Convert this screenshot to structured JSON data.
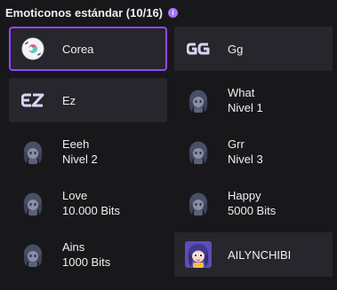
{
  "header": {
    "title": "Emoticonos estándar (10/16)",
    "info_icon": "info-icon",
    "info_glyph": "i"
  },
  "colors": {
    "background": "#18181b",
    "tile": "#26262c",
    "accent": "#9147ff",
    "info": "#a970ff",
    "text": "#efeff1"
  },
  "emotes": [
    {
      "line1": "Corea",
      "line2": "",
      "icon": "korea-flag-badge-icon",
      "state": "selected"
    },
    {
      "line1": "Gg",
      "line2": "",
      "icon": "gg-logo-icon",
      "state": "unlocked"
    },
    {
      "line1": "Ez",
      "line2": "",
      "icon": "ez-logo-icon",
      "state": "unlocked"
    },
    {
      "line1": "What",
      "line2": "Nivel 1",
      "icon": "chibi-silhouette-icon",
      "state": "locked"
    },
    {
      "line1": "Eeeh",
      "line2": "Nivel 2",
      "icon": "chibi-silhouette-icon",
      "state": "locked"
    },
    {
      "line1": "Grr",
      "line2": "Nivel 3",
      "icon": "chibi-silhouette-icon",
      "state": "locked"
    },
    {
      "line1": "Love",
      "line2": "10.000 Bits",
      "icon": "chibi-silhouette-icon",
      "state": "locked"
    },
    {
      "line1": "Happy",
      "line2": "5000 Bits",
      "icon": "chibi-silhouette-icon",
      "state": "locked"
    },
    {
      "line1": "Ains",
      "line2": "1000 Bits",
      "icon": "chibi-silhouette-icon",
      "state": "locked"
    },
    {
      "line1": "AILYNCHIBI",
      "line2": "",
      "icon": "chibi-avatar-icon",
      "state": "unlocked"
    }
  ]
}
